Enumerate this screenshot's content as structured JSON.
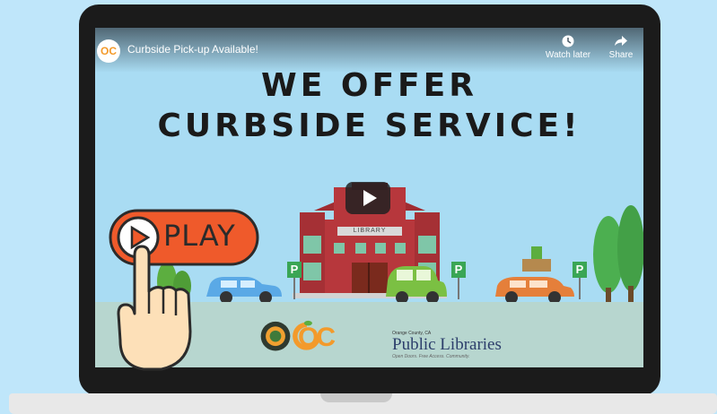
{
  "video": {
    "title": "Curbside Pick-up Available!",
    "channel_logo_text": "OC",
    "actions": [
      {
        "label": "Watch later",
        "icon": "clock-icon"
      },
      {
        "label": "Share",
        "icon": "share-arrow-icon"
      }
    ]
  },
  "headline": {
    "line1": "WE OFFER",
    "line2": "CURBSIDE SERVICE!"
  },
  "scene": {
    "building_sign": "LIBRARY",
    "parking_sign": "P"
  },
  "footer": {
    "oc_mark": "OC",
    "library_small": "Orange County, CA",
    "library_name": "Public Libraries",
    "library_tagline": "Open Doors. Free Access. Community."
  },
  "overlay": {
    "play_label": "PLAY"
  },
  "colors": {
    "background": "#bfe6fa",
    "play_badge": "#ef5a2b",
    "library_red": "#b7373c",
    "car_blue": "#5aa9e6",
    "car_green": "#7bc043",
    "car_orange": "#e57f3a"
  }
}
